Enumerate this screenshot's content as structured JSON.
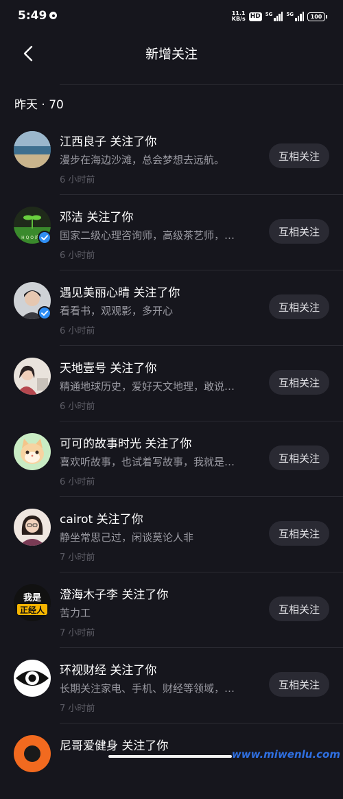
{
  "status_bar": {
    "time": "5:49",
    "speed_value": "11.1",
    "speed_unit": "KB/s",
    "hd": "HD",
    "sim1_label": "5G",
    "sim2_label": "5G",
    "battery": "100"
  },
  "header": {
    "back_icon": "chevron-left-icon",
    "title": "新增关注"
  },
  "section": {
    "label": "昨天 · 70"
  },
  "followers": [
    {
      "name": "江西良子",
      "action": " 关注了你",
      "bio": "漫步在海边沙滩，总会梦想去远航。",
      "time": "6 小时前",
      "button": "互相关注",
      "verified": false
    },
    {
      "name": "邓洁",
      "action": " 关注了你",
      "bio": "国家二级心理咨询师，高级茶艺师，…",
      "time": "6 小时前",
      "button": "互相关注",
      "verified": true
    },
    {
      "name": "遇见美丽心晴",
      "action": " 关注了你",
      "bio": "看看书，观观影，多开心",
      "time": "6 小时前",
      "button": "互相关注",
      "verified": true
    },
    {
      "name": "天地壹号",
      "action": " 关注了你",
      "bio": "精通地球历史，爱好天文地理，敢说…",
      "time": "6 小时前",
      "button": "互相关注",
      "verified": false
    },
    {
      "name": "可可的故事时光",
      "action": " 关注了你",
      "bio": "喜欢听故事，也试着写故事，我就是…",
      "time": "6 小时前",
      "button": "互相关注",
      "verified": false
    },
    {
      "name": "cairot",
      "action": " 关注了你",
      "bio": "静坐常思己过，闲谈莫论人非",
      "time": "7 小时前",
      "button": "互相关注",
      "verified": false
    },
    {
      "name": "澄海木子李",
      "action": " 关注了你",
      "bio": "苦力工",
      "time": "7 小时前",
      "button": "互相关注",
      "verified": false
    },
    {
      "name": "环视财经",
      "action": " 关注了你",
      "bio": "长期关注家电、手机、财经等领域，…",
      "time": "7 小时前",
      "button": "互相关注",
      "verified": false
    },
    {
      "name": "尼哥爱健身",
      "action": " 关注了你",
      "bio": "",
      "time": "",
      "button": "",
      "verified": false
    }
  ],
  "avatar_texts": {
    "a2_caption": "H Q O 的心",
    "a7_top": "我是",
    "a7_bottom": "正经人"
  },
  "watermark": "www.miwenlu.com",
  "colors": {
    "background": "#16161d",
    "button_bg": "#2a2a33",
    "secondary_text": "#9a9aa2",
    "verified": "#2f8ef4"
  }
}
